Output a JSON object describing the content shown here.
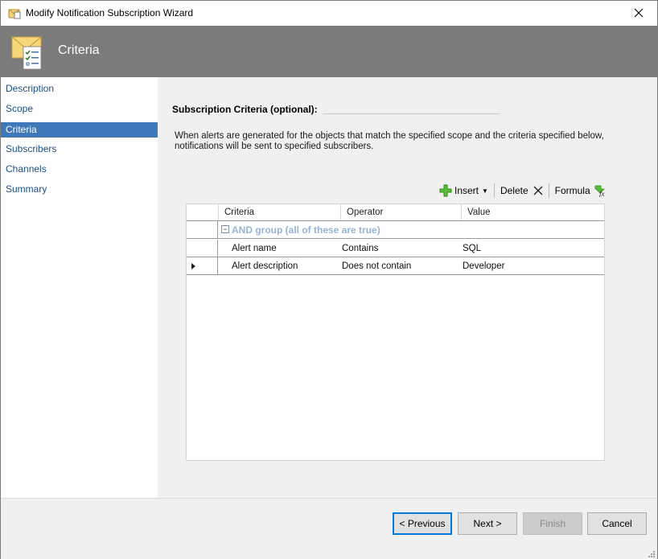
{
  "window": {
    "title": "Modify Notification Subscription Wizard"
  },
  "header": {
    "title": "Criteria",
    "icon": "envelope-checklist-icon"
  },
  "nav": {
    "items": [
      {
        "label": "Description",
        "selected": false
      },
      {
        "label": "Scope",
        "selected": false
      },
      {
        "label": "Criteria",
        "selected": true
      },
      {
        "label": "Subscribers",
        "selected": false
      },
      {
        "label": "Channels",
        "selected": false
      },
      {
        "label": "Summary",
        "selected": false
      }
    ]
  },
  "main": {
    "section_title": "Subscription Criteria (optional):",
    "description": "When alerts are generated for the objects that match the specified scope and the criteria specified below, notifications will be sent to specified subscribers.",
    "toolbar": {
      "insert_label": "Insert",
      "delete_label": "Delete",
      "formula_label": "Formula"
    },
    "grid": {
      "columns": [
        "Criteria",
        "Operator",
        "Value"
      ],
      "group_label": "AND group (all of these are true)",
      "rows": [
        {
          "criteria": "Alert name",
          "operator": "Contains",
          "value": "SQL"
        },
        {
          "criteria": "Alert description",
          "operator": "Does not contain",
          "value": "Developer"
        }
      ]
    }
  },
  "footer": {
    "previous_label": "< Previous",
    "next_label": "Next >",
    "finish_label": "Finish",
    "cancel_label": "Cancel"
  },
  "colors": {
    "banner": "#7b7b7b",
    "nav_selected": "#3f78b8",
    "nav_link": "#1c4f86",
    "primary_focus": "#0078d7"
  }
}
